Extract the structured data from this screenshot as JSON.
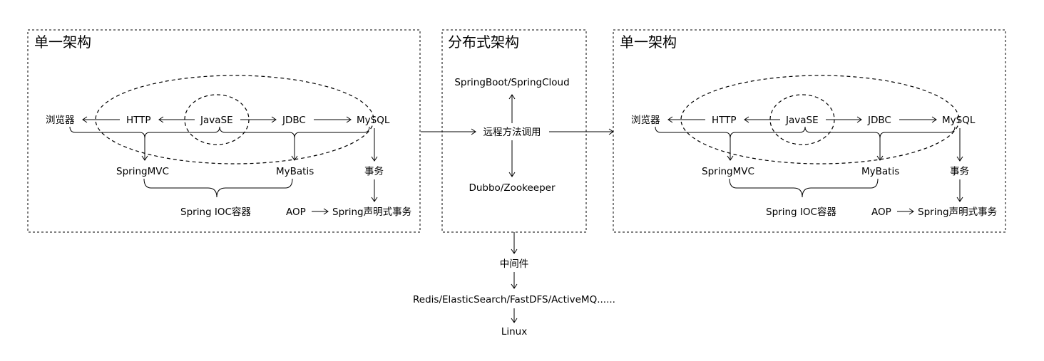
{
  "left_panel": {
    "title": "单一架构",
    "browser": "浏览器",
    "http": "HTTP",
    "javase": "JavaSE",
    "jdbc": "JDBC",
    "mysql": "MySQL",
    "springmvc": "SpringMVC",
    "mybatis": "MyBatis",
    "transaction": "事务",
    "ioc": "Spring IOC容器",
    "aop": "AOP",
    "declarative_tx": "Spring声明式事务"
  },
  "middle_panel": {
    "title": "分布式架构",
    "springboot": "SpringBoot/SpringCloud",
    "rpc": "远程方法调用",
    "dubbo": "Dubbo/Zookeeper"
  },
  "right_panel": {
    "title": "单一架构",
    "browser": "浏览器",
    "http": "HTTP",
    "javase": "JavaSE",
    "jdbc": "JDBC",
    "mysql": "MySQL",
    "springmvc": "SpringMVC",
    "mybatis": "MyBatis",
    "transaction": "事务",
    "ioc": "Spring IOC容器",
    "aop": "AOP",
    "declarative_tx": "Spring声明式事务"
  },
  "bottom": {
    "middleware": "中间件",
    "tools": "Redis/ElasticSearch/FastDFS/ActiveMQ......",
    "linux": "Linux"
  }
}
